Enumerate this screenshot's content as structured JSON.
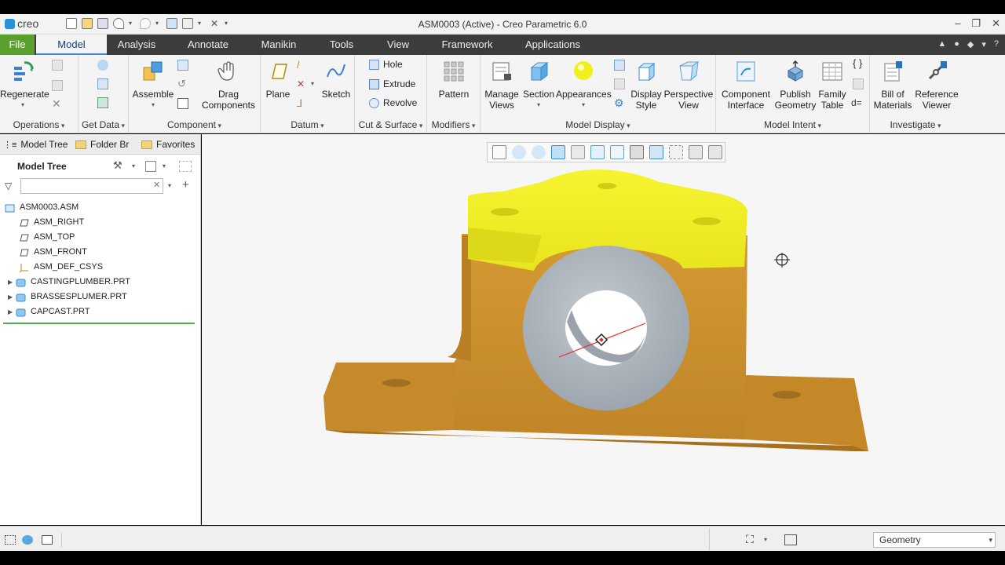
{
  "app": {
    "logo_text": "creo",
    "window_title": "ASM0003 (Active) - Creo Parametric 6.0",
    "window_controls": [
      "–",
      "❐",
      "✕"
    ]
  },
  "tabs": [
    {
      "label": "File"
    },
    {
      "label": "Model"
    },
    {
      "label": "Analysis"
    },
    {
      "label": "Annotate"
    },
    {
      "label": "Manikin"
    },
    {
      "label": "Tools"
    },
    {
      "label": "View"
    },
    {
      "label": "Framework"
    },
    {
      "label": "Applications"
    }
  ],
  "ribbon": {
    "operations": {
      "label": "Operations",
      "regenerate": "Regenerate"
    },
    "get_data": {
      "label": "Get Data"
    },
    "component": {
      "label": "Component",
      "assemble": "Assemble",
      "drag_components_1": "Drag",
      "drag_components_2": "Components"
    },
    "datum": {
      "label": "Datum",
      "plane": "Plane",
      "sketch": "Sketch"
    },
    "cut_surface": {
      "label": "Cut & Surface",
      "hole": "Hole",
      "extrude": "Extrude",
      "revolve": "Revolve"
    },
    "modifiers": {
      "label": "Modifiers",
      "pattern": "Pattern"
    },
    "model_display": {
      "label": "Model Display",
      "manage_views_1": "Manage",
      "manage_views_2": "Views",
      "section": "Section",
      "appearances": "Appearances",
      "display_style_1": "Display",
      "display_style_2": "Style",
      "perspective_view_1": "Perspective",
      "perspective_view_2": "View"
    },
    "model_intent": {
      "label": "Model Intent",
      "component_interface_1": "Component",
      "component_interface_2": "Interface",
      "publish_geometry_1": "Publish",
      "publish_geometry_2": "Geometry",
      "family_table_1": "Family",
      "family_table_2": "Table",
      "relations_symbol": "d="
    },
    "investigate": {
      "label": "Investigate",
      "bill_of_materials_1": "Bill of",
      "bill_of_materials_2": "Materials",
      "reference_viewer_1": "Reference",
      "reference_viewer_2": "Viewer"
    }
  },
  "left_pane": {
    "tabs": [
      "Model Tree",
      "Folder Br",
      "Favorites"
    ],
    "header": "Model Tree",
    "search_value": "",
    "tree": [
      {
        "label": "ASM0003.ASM",
        "icon": "assembly-icon",
        "expandable": false,
        "indent": 0
      },
      {
        "label": "ASM_RIGHT",
        "icon": "datum-plane-icon",
        "expandable": false,
        "indent": 1
      },
      {
        "label": "ASM_TOP",
        "icon": "datum-plane-icon",
        "expandable": false,
        "indent": 1
      },
      {
        "label": "ASM_FRONT",
        "icon": "datum-plane-icon",
        "expandable": false,
        "indent": 1
      },
      {
        "label": "ASM_DEF_CSYS",
        "icon": "csys-icon",
        "expandable": false,
        "indent": 1
      },
      {
        "label": "CASTINGPLUMBER.PRT",
        "icon": "part-icon",
        "expandable": true,
        "indent": 1
      },
      {
        "label": "BRASSESPLUMER.PRT",
        "icon": "part-icon",
        "expandable": true,
        "indent": 1
      },
      {
        "label": "CAPCAST.PRT",
        "icon": "part-icon",
        "expandable": true,
        "indent": 1
      }
    ]
  },
  "viewport": {
    "model": "plummer-block-assembly",
    "colors": {
      "base": "#c88e2e",
      "cap": "#f0ee2a",
      "brass": "#a7adb5",
      "background": "#f6f6f6"
    }
  },
  "status": {
    "selection_filter": "Geometry"
  },
  "colors": {
    "file_tab": "#5aa02c",
    "tab_bar": "#3c3c3c",
    "accent": "#4a8ad4"
  }
}
